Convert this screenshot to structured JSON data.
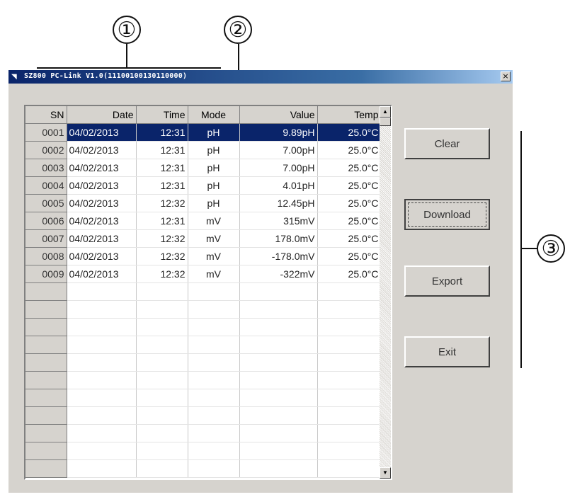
{
  "callouts": [
    "①",
    "②",
    "③"
  ],
  "window": {
    "title": "SZ800 PC-Link V1.0(11100100130110000)",
    "close_glyph": "×"
  },
  "grid": {
    "columns": [
      "SN",
      "Date",
      "Time",
      "Mode",
      "Value",
      "Temp"
    ],
    "rows": [
      {
        "sn": "0001",
        "date": "04/02/2013",
        "time": "12:31",
        "mode": "pH",
        "value": "9.89pH",
        "temp": "25.0°C",
        "selected": true
      },
      {
        "sn": "0002",
        "date": "04/02/2013",
        "time": "12:31",
        "mode": "pH",
        "value": "7.00pH",
        "temp": "25.0°C"
      },
      {
        "sn": "0003",
        "date": "04/02/2013",
        "time": "12:31",
        "mode": "pH",
        "value": "7.00pH",
        "temp": "25.0°C"
      },
      {
        "sn": "0004",
        "date": "04/02/2013",
        "time": "12:31",
        "mode": "pH",
        "value": "4.01pH",
        "temp": "25.0°C"
      },
      {
        "sn": "0005",
        "date": "04/02/2013",
        "time": "12:32",
        "mode": "pH",
        "value": "12.45pH",
        "temp": "25.0°C"
      },
      {
        "sn": "0006",
        "date": "04/02/2013",
        "time": "12:31",
        "mode": "mV",
        "value": "315mV",
        "temp": "25.0°C"
      },
      {
        "sn": "0007",
        "date": "04/02/2013",
        "time": "12:32",
        "mode": "mV",
        "value": "178.0mV",
        "temp": "25.0°C"
      },
      {
        "sn": "0008",
        "date": "04/02/2013",
        "time": "12:32",
        "mode": "mV",
        "value": "-178.0mV",
        "temp": "25.0°C"
      },
      {
        "sn": "0009",
        "date": "04/02/2013",
        "time": "12:32",
        "mode": "mV",
        "value": "-322mV",
        "temp": "25.0°C"
      }
    ],
    "empty_rows": 11,
    "scroll_up_glyph": "▲",
    "scroll_down_glyph": "▼"
  },
  "buttons": {
    "clear": "Clear",
    "download": "Download",
    "export": "Export",
    "exit": "Exit"
  },
  "colors": {
    "selection": "#0a246a",
    "window_face": "#d6d3ce",
    "titlebar": "#0a246a"
  }
}
